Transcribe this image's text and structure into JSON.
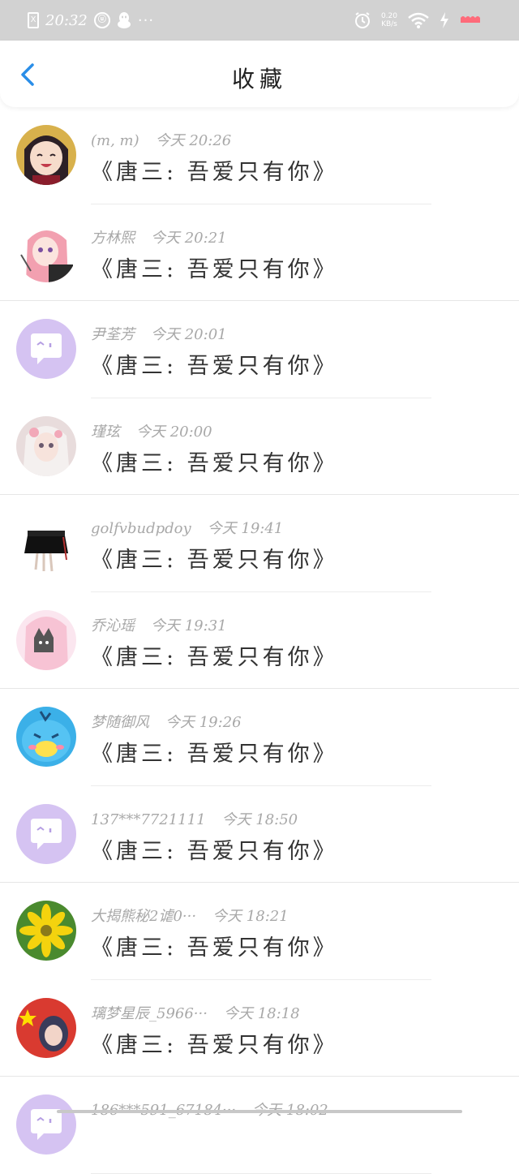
{
  "status_bar": {
    "time": "20:32",
    "speed_value": "0.20",
    "speed_unit": "KB/s",
    "sim_label": "X",
    "dots": "···"
  },
  "nav": {
    "back_icon": "chevron-left",
    "title": "收藏",
    "accent_color": "#2a8ee8"
  },
  "items": [
    {
      "user": "(m, m)",
      "time": "今天 20:26",
      "title": "《唐三: 吾爱只有你》",
      "avatar": "anime-girl-dark-hair"
    },
    {
      "user": "方林熙",
      "time": "今天 20:21",
      "title": "《唐三: 吾爱只有你》",
      "avatar": "anime-girl-pink-hair"
    },
    {
      "user": "尹荃芳",
      "time": "今天 20:01",
      "title": "《唐三: 吾爱只有你》",
      "avatar": "default-chat-bubble"
    },
    {
      "user": "瑾玹",
      "time": "今天 20:00",
      "title": "《唐三: 吾爱只有你》",
      "avatar": "doll-girl"
    },
    {
      "user": "golfvbudpdoy",
      "time": "今天 19:41",
      "title": "《唐三: 吾爱只有你》",
      "avatar": "black-skirt"
    },
    {
      "user": "乔沁瑶",
      "time": "今天 19:31",
      "title": "《唐三: 吾爱只有你》",
      "avatar": "pink-cat-girl"
    },
    {
      "user": "梦随御风",
      "time": "今天 19:26",
      "title": "《唐三: 吾爱只有你》",
      "avatar": "blue-duck"
    },
    {
      "user": "137***7721111",
      "time": "今天 18:50",
      "title": "《唐三: 吾爱只有你》",
      "avatar": "default-chat-bubble"
    },
    {
      "user": "大揭熊秘2谑0···",
      "time": "今天 18:21",
      "title": "《唐三: 吾爱只有你》",
      "avatar": "yellow-flower"
    },
    {
      "user": "璃梦星辰_5966···",
      "time": "今天 18:18",
      "title": "《唐三: 吾爱只有你》",
      "avatar": "flag-girl"
    },
    {
      "user": "186***591_67184···",
      "time": "今天 18:02",
      "title": "",
      "avatar": "default-chat-bubble"
    }
  ]
}
